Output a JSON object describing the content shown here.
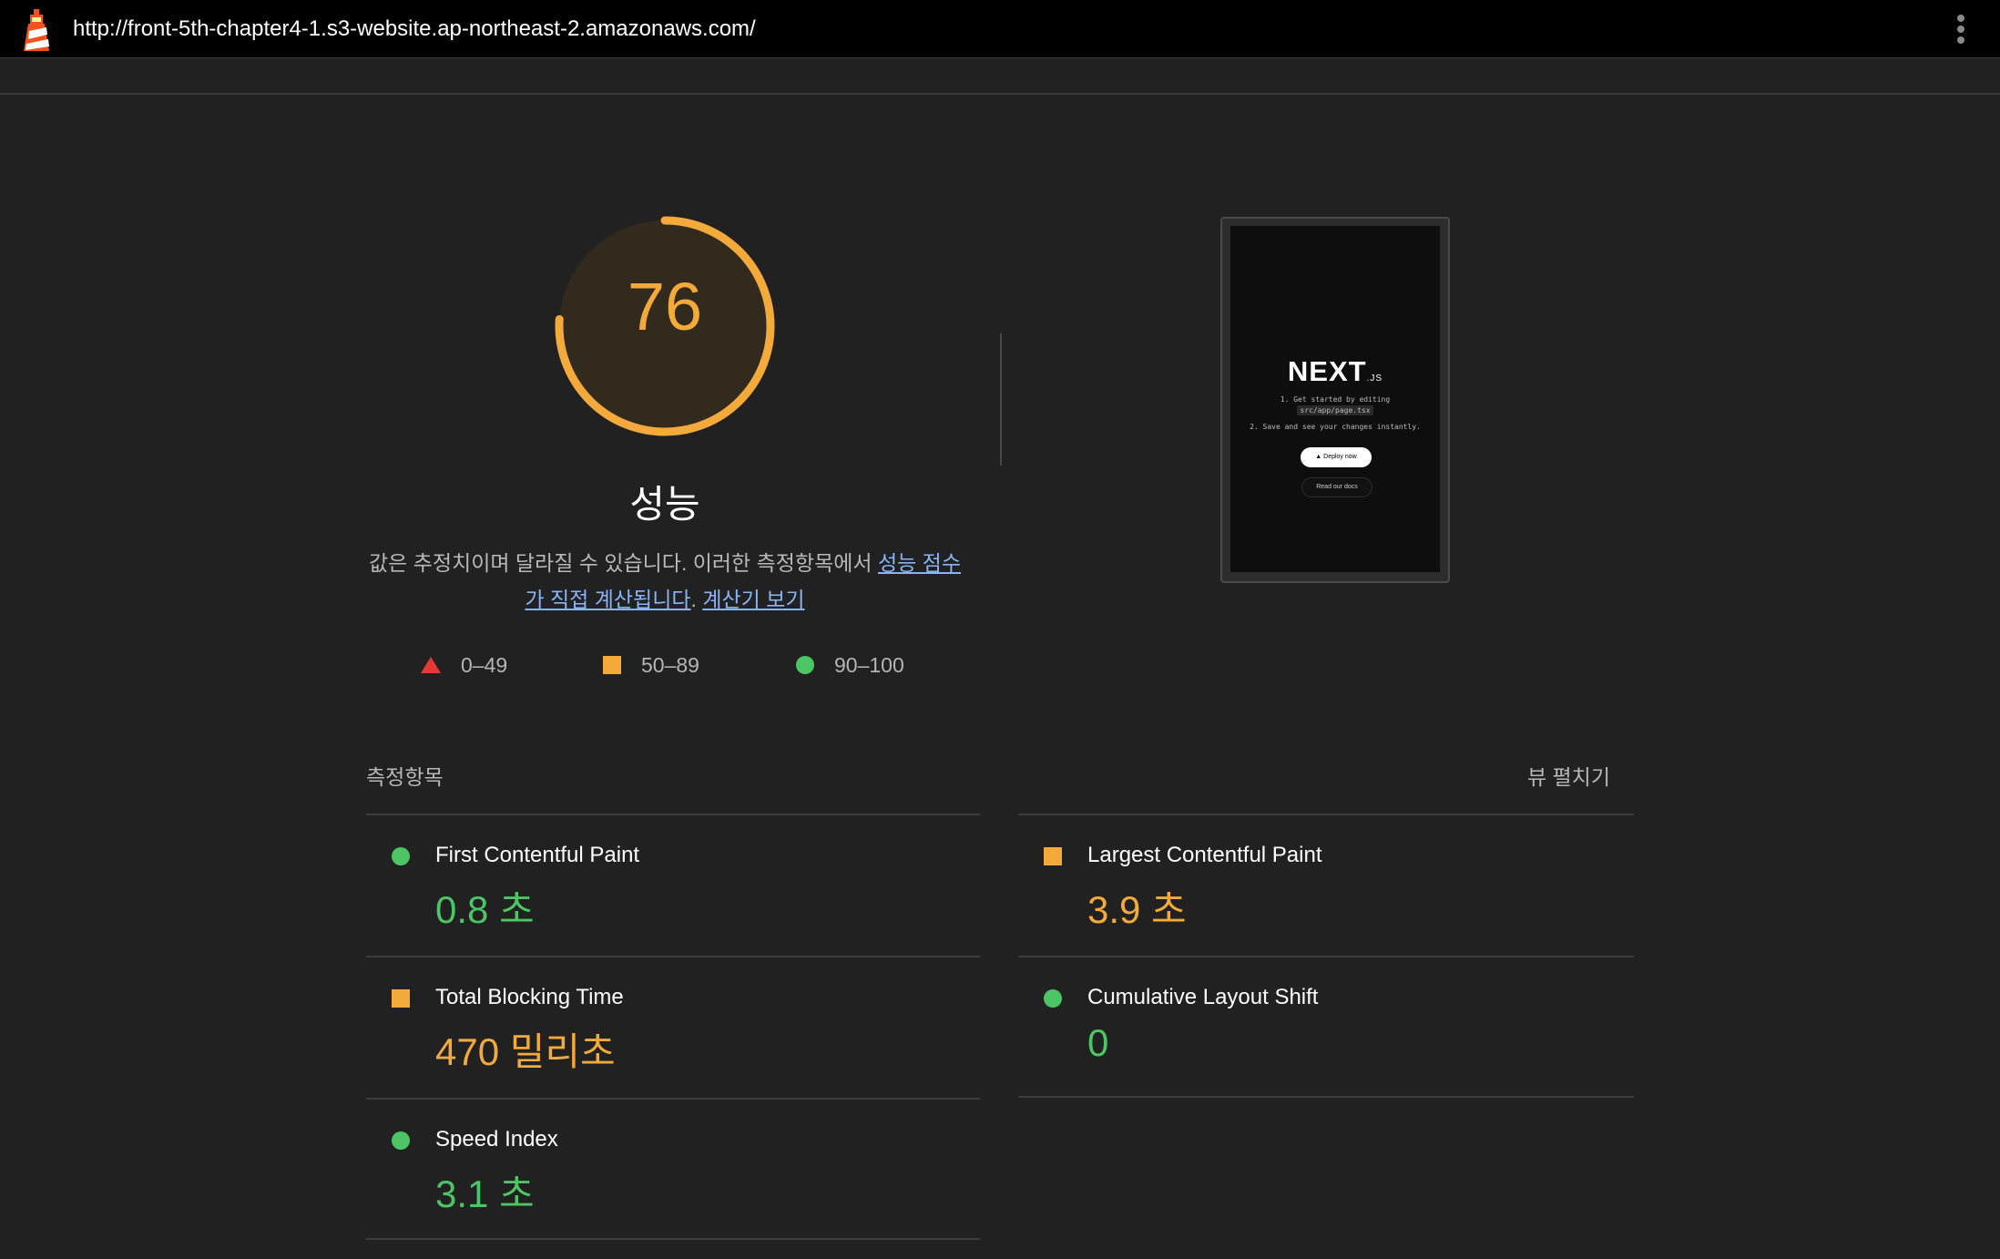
{
  "topbar": {
    "url": "http://front-5th-chapter4-1.s3-website.ap-northeast-2.amazonaws.com/",
    "logo_icon": "lighthouse-icon",
    "menu_icon": "kebab-menu-icon"
  },
  "gauge": {
    "score": "76",
    "score_fraction": 0.76,
    "title": "성능",
    "color": "#f4a93b"
  },
  "description": {
    "text_before": "값은 추정치이며 달라질 수 있습니다. 이러한 측정항목에서 ",
    "link1": "성능 점수가 직접 계산됩니다",
    "text_between": ". ",
    "link2": "계산기 보기"
  },
  "legend": [
    {
      "shape": "triangle",
      "color": "#e53935",
      "label": "0–49"
    },
    {
      "shape": "square",
      "color": "#f4a93b",
      "label": "50–89"
    },
    {
      "shape": "circle",
      "color": "#4cc665",
      "label": "90–100"
    }
  ],
  "screenshot_thumb": {
    "brand": "NEXT",
    "brand_suffix": ".JS",
    "line1": "1. Get started by editing",
    "line2": "src/app/page.tsx",
    "line3": "2. Save and see your changes instantly.",
    "deploy_button": "▲  Deploy now",
    "docs_button": "Read our docs"
  },
  "metrics": {
    "title": "측정항목",
    "expand_label": "뷰 펼치기",
    "items": [
      {
        "name": "First Contentful Paint",
        "value": "0.8 초",
        "status": "good"
      },
      {
        "name": "Largest Contentful Paint",
        "value": "3.9 초",
        "status": "average"
      },
      {
        "name": "Total Blocking Time",
        "value": "470 밀리초",
        "status": "average"
      },
      {
        "name": "Cumulative Layout Shift",
        "value": "0",
        "status": "good"
      },
      {
        "name": "Speed Index",
        "value": "3.1 초",
        "status": "good"
      }
    ]
  }
}
